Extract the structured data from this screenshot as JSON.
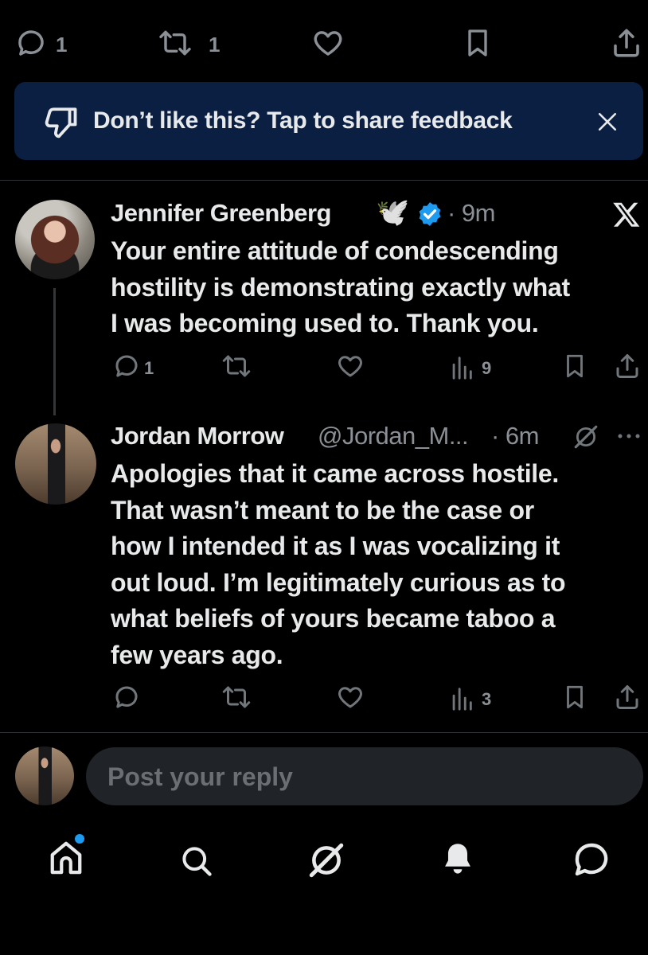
{
  "top_actions": {
    "reply_count": "1",
    "repost_count": "1"
  },
  "feedback_banner": {
    "text": "Don’t like this? Tap to share feedback"
  },
  "tweets": [
    {
      "name": "Jennifer Greenberg",
      "emoji": "🕊️",
      "time": "· 9m",
      "text_lines": [
        "Your entire attitude of condescending",
        "hostility is demonstrating exactly what",
        "I was becoming used to. Thank you."
      ],
      "reply_count": "1",
      "views": "9"
    },
    {
      "name": "Jordan Morrow",
      "handle": "@Jordan_M...",
      "time": "· 6m",
      "text_lines": [
        "Apologies that it came across hostile.",
        "That wasn’t meant to be the case or",
        "how I intended it as I was vocalizing it",
        "out loud. I’m legitimately curious as to",
        "what beliefs of yours became taboo a",
        "few years ago."
      ],
      "views": "3"
    }
  ],
  "reply_composer": {
    "placeholder": "Post your reply"
  },
  "colors": {
    "background": "#000000",
    "banner": "#0b1f43",
    "verified": "#1d9bf0",
    "muted": "#71767b",
    "notification_dot": "#1d9bf0"
  }
}
